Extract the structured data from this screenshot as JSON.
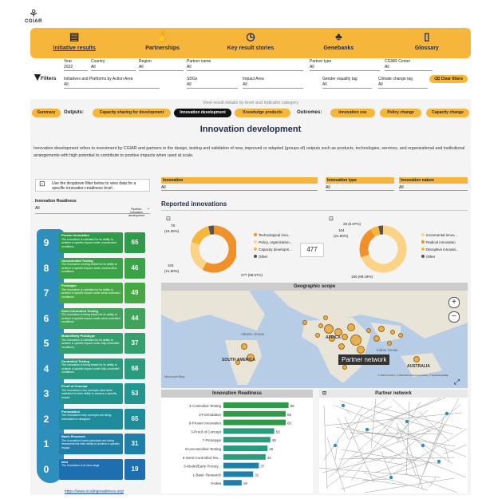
{
  "brand": {
    "logo_text": "CGIAR"
  },
  "nav": [
    {
      "label": "Initiative results",
      "icon": "document-icon",
      "active": true
    },
    {
      "label": "Partnerships",
      "icon": "handshake-icon",
      "active": false
    },
    {
      "label": "Key result stories",
      "icon": "clock-icon",
      "active": false
    },
    {
      "label": "Genebanks",
      "icon": "seedling-icon",
      "active": false
    },
    {
      "label": "Glossary",
      "icon": "book-icon",
      "active": false
    }
  ],
  "filters": {
    "label": "Filters",
    "fields": [
      {
        "name": "Year",
        "value": "2022"
      },
      {
        "name": "Country",
        "value": "All"
      },
      {
        "name": "Region",
        "value": "All"
      },
      {
        "name": "Partner name",
        "value": "All"
      },
      {
        "name": "Partner type",
        "value": "All"
      },
      {
        "name": "CGIAR Center",
        "value": "All"
      },
      {
        "name": "Initiatives and Platforms by Action Area",
        "value": "All"
      },
      {
        "name": "SDGs",
        "value": "All"
      },
      {
        "name": "Impact Area",
        "value": "All"
      },
      {
        "name": "Gender equality tag",
        "value": "All"
      },
      {
        "name": "Climate change tag",
        "value": "All"
      }
    ],
    "clear_label": "Clear filters"
  },
  "view_text": "View result details by level and indicator category",
  "tabs": {
    "summary": "Summary",
    "outputs_label": "Outputs:",
    "outputs": [
      "Capacity sharing for development",
      "Innovation development",
      "Knowledge products"
    ],
    "outcomes_label": "Outcomes:",
    "outcomes": [
      "Innovation use",
      "Policy change",
      "Capacity change"
    ]
  },
  "page_title": "Innovation development",
  "description": "Innovation development refers to investment by CGIAR and partners in the design, testing and validation of new, improved or adapted (groups of) outputs such as products, technologies, services, and organizational and institutional arrangements with high potential to contribute to positive impacts when used at scale.",
  "callout": "Use the dropdown filter below to view data for a specific innovation readiness level.",
  "readiness_filter": {
    "label": "Innovation Readiness",
    "value": "All"
  },
  "top_filters": [
    {
      "label": "Innovation",
      "value": "All"
    },
    {
      "label": "Innovation type",
      "value": "All"
    },
    {
      "label": "Innovation nature",
      "value": "All"
    }
  ],
  "reported_title": "Reported innovations",
  "pipeline_header": "Pipeline: innovation development",
  "levels": [
    {
      "n": "9",
      "title": "Proven Innovation",
      "text": "The innovation is validated for its ability to achieve a specific impact under uncontrolled conditions",
      "value": "65",
      "color": "#2f9b48"
    },
    {
      "n": "8",
      "title": "Uncontrolled Testing",
      "text": "The innovation is being tested for its ability to achieve a specific impact under uncontrolled conditions",
      "value": "46",
      "color": "#3aa345"
    },
    {
      "n": "7",
      "title": "Prototype",
      "text": "The innovation is validated for its ability to achieve a specific impact under semi-controlled conditions",
      "value": "49",
      "color": "#46a844"
    },
    {
      "n": "6",
      "title": "Semi-Controlled Testing",
      "text": "The innovation is being tested for its ability to achieve a specific impact under semi-controlled conditions",
      "value": "44",
      "color": "#3fa35a"
    },
    {
      "n": "5",
      "title": "Model/Early Prototype",
      "text": "The innovation is validated for its ability to achieve a specific impact under fully-controlled conditions",
      "value": "37",
      "color": "#35a06e"
    },
    {
      "n": "4",
      "title": "Controlled Testing",
      "text": "The innovation is being tested for its ability to achieve a specific impact under fully-controlled conditions",
      "value": "68",
      "color": "#2b9b7e"
    },
    {
      "n": "3",
      "title": "Proof of Concept",
      "text": "The innovation's key concepts have been validated for their ability to achieve a specific impact",
      "value": "53",
      "color": "#23958e"
    },
    {
      "n": "2",
      "title": "Formulation",
      "text": "The innovation's key concepts are being formulated or designed",
      "value": "65",
      "color": "#1f8c9c"
    },
    {
      "n": "1",
      "title": "Basic Research",
      "text": "The innovation's basic principles are being researched for their ability to achieve a specific impact",
      "value": "31",
      "color": "#1f7fa8"
    },
    {
      "n": "0",
      "title": "Idea",
      "text": "The innovation is at idea stage",
      "value": "19",
      "color": "#1e6fb2"
    }
  ],
  "scaling_url": "https://www.scalingreadiness.org/",
  "donut1": {
    "labels_text": [
      "78",
      "(16.35%)",
      "104",
      "(21.80%)",
      "277 (58.07%)"
    ],
    "legend": [
      "Technological inno...",
      "Policy, organization...",
      "Capacity developm...",
      "Other"
    ],
    "colors": [
      "#f0902a",
      "#fbd386",
      "#f6b63c",
      "#555555"
    ],
    "values": [
      277,
      104,
      78,
      18
    ]
  },
  "total_value": "477",
  "donut2": {
    "labels_text": [
      "28 (5.87%)",
      "104",
      "(21.80%)",
      "150 (69.18%)"
    ],
    "legend": [
      "Incremental innov...",
      "Radical innovation",
      "Disruptive innovati...",
      "Other"
    ],
    "colors": [
      "#fbd386",
      "#f0902a",
      "#f6b63c",
      "#555555"
    ],
    "values": [
      330,
      104,
      28,
      15
    ]
  },
  "geo": {
    "title": "Geographic scope",
    "labels": [
      "Atlantic Ocean",
      "AFRICA",
      "SOUTH AMERICA",
      "AUSTRALIA",
      "Indian Ocean"
    ],
    "tooltip": "Partner network",
    "credit": "© 2023 TomTom, © 2023 Microsoft Corporation, © OpenStreetMap"
  },
  "chart_data": {
    "type": "bar",
    "title": "Innovation Readiness",
    "categories": [
      "4-Controlled Testing",
      "2-Formulation",
      "9-Proven Innovation",
      "3-Proof of Concept",
      "7-Prototype",
      "8-Uncontrolled Testing",
      "6-Semi-Controlled Tes...",
      "5-Model/Early Prototy...",
      "1-Basic Research",
      "0-Idea"
    ],
    "values": [
      68,
      65,
      65,
      53,
      49,
      46,
      44,
      37,
      31,
      19
    ],
    "xlim": [
      0,
      80
    ]
  },
  "partner_network": {
    "title": "Partner network"
  }
}
